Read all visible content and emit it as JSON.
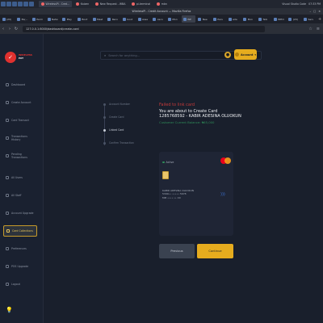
{
  "os": {
    "tasks": [
      "WirelessPi - Cred...",
      "Kaizen",
      "New Request - WBA",
      "pi-terminal",
      "mbn"
    ],
    "active_task": "WirelessPi - Cred...",
    "right_app": "Visual Studio Code",
    "time": "07:33 PM"
  },
  "browser": {
    "window_title": "WirelessPi - Credit Account — Mozilla Firefox",
    "tabs": [
      "(20)",
      "BL(...",
      "Perm",
      "Netw",
      "Play",
      "Boot",
      "Mast",
      "Reco",
      "boot",
      "Asse",
      "Asco",
      "Mon",
      "WP",
      "Nee",
      "Pers",
      "ada",
      "Mon",
      "Telx",
      "WHO",
      "(20)",
      "Serv"
    ],
    "active_tab_index": 12,
    "url": "127.0.0.1:8000/dashboard/create-card"
  },
  "sidebar": {
    "brand_line1": "WIRELESS",
    "brand_line2": "PAY",
    "items": [
      {
        "label": "Dashboard",
        "icon": "grid-icon"
      },
      {
        "label": "Create Account",
        "icon": "user-plus-icon"
      },
      {
        "label": "Card Transact",
        "icon": "card-icon"
      },
      {
        "label": "Transactions History",
        "icon": "history-icon"
      },
      {
        "label": "Pending Transactions",
        "icon": "clock-icon"
      },
      {
        "label": "All Users",
        "icon": "users-icon"
      },
      {
        "label": "All Staff",
        "icon": "staff-icon"
      },
      {
        "label": "Account Upgrade",
        "icon": "upgrade-icon"
      },
      {
        "label": "Card Collections",
        "icon": "wallet-icon"
      },
      {
        "label": "Preferences",
        "icon": "sliders-icon"
      },
      {
        "label": "POS Upgrade",
        "icon": "pos-icon"
      },
      {
        "label": "Logout",
        "icon": "logout-icon"
      }
    ],
    "active_index": 8
  },
  "topbar": {
    "search_placeholder": "Search for anything...",
    "account_label": "Account"
  },
  "steps": {
    "items": [
      "Account Number",
      "Create Card",
      "Linked Card",
      "Confirm Transaction"
    ],
    "active_index": 2
  },
  "confirm": {
    "failed_text": "Failed to link card",
    "about_text": "You are about to Create Card",
    "name_text": "1285768592 - KABIR ADESINA OLUOKUN",
    "balance_text": "Customer Current Balance: ₦65,000"
  },
  "card": {
    "status": "Active",
    "holder_name": "KABIR ADESINA OLUOKUN",
    "card_number": "5399•• ••••• 5678",
    "expiry": "MM •••• •• XX"
  },
  "buttons": {
    "previous": "Previous",
    "continue": "Continue"
  },
  "colors": {
    "accent": "#e6ac1e",
    "error": "#c43a3a",
    "success": "#2f8e59",
    "mastercard_red": "#eb001b",
    "mastercard_orange": "#f79e1b"
  }
}
